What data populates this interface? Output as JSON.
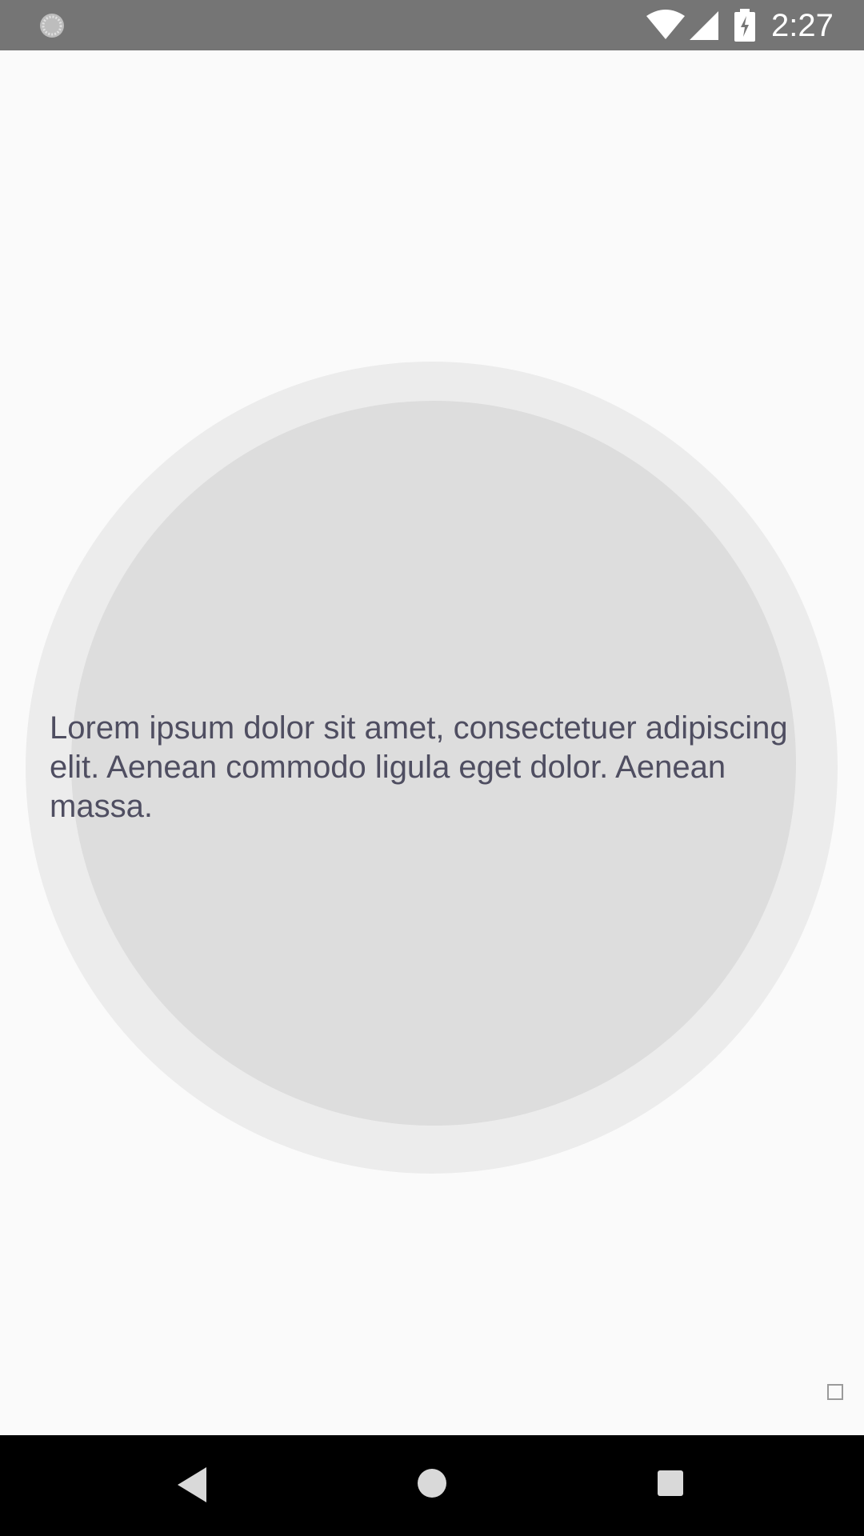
{
  "status_bar": {
    "time": "2:27",
    "left_icon": "loading-spinner-icon",
    "wifi_icon": "wifi-icon",
    "signal_icon": "cell-signal-icon",
    "battery_icon": "battery-charging-icon"
  },
  "main": {
    "text": "Lorem ipsum dolor sit amet, consectetuer adipiscing elit. Aenean commodo ligula eget dolor. Aenean massa.",
    "corner_icon": "square-outline-icon"
  },
  "nav_bar": {
    "back_icon": "back-triangle-icon",
    "home_icon": "home-circle-icon",
    "recents_icon": "recents-square-icon"
  },
  "colors": {
    "status_bar": "#757575",
    "background": "#fafafa",
    "outer_circle": "#ececec",
    "inner_circle": "#dddddd",
    "text": "#4f4e61",
    "nav_bar": "#000000"
  }
}
